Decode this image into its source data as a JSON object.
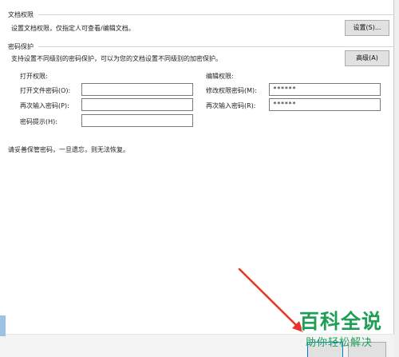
{
  "doc_perm": {
    "title": "文档权限",
    "desc": "设置文档权限，仅指定人可查看/编辑文档。",
    "settings_btn": "设置(S)..."
  },
  "pwd_protect": {
    "title": "密码保护",
    "desc": "支持设置不同级别的密码保护，可以为您的文档设置不同级别的加密保护。",
    "advanced_btn": "高级(A)"
  },
  "open_perm": {
    "heading": "打开权限:",
    "open_pwd_label": "打开文件密码(O):",
    "reenter_label": "再次输入密码(P):",
    "hint_label": "密码提示(H):",
    "open_pwd_value": "",
    "reenter_value": "",
    "hint_value": ""
  },
  "edit_perm": {
    "heading": "编辑权限:",
    "modify_pwd_label": "修改权限密码(M):",
    "reenter_label": "再次输入密码(R):",
    "modify_pwd_value": "******",
    "reenter_value": "******"
  },
  "warning": "请妥善保管密码，一旦遗忘，则无法恢复。",
  "footer": {
    "ok_label": ""
  },
  "watermark": {
    "main": "百科全说",
    "sub": "助你轻松解决"
  },
  "colors": {
    "accent": "#0078d7",
    "watermark": "#1e9f55",
    "arrow": "#e8332b"
  }
}
